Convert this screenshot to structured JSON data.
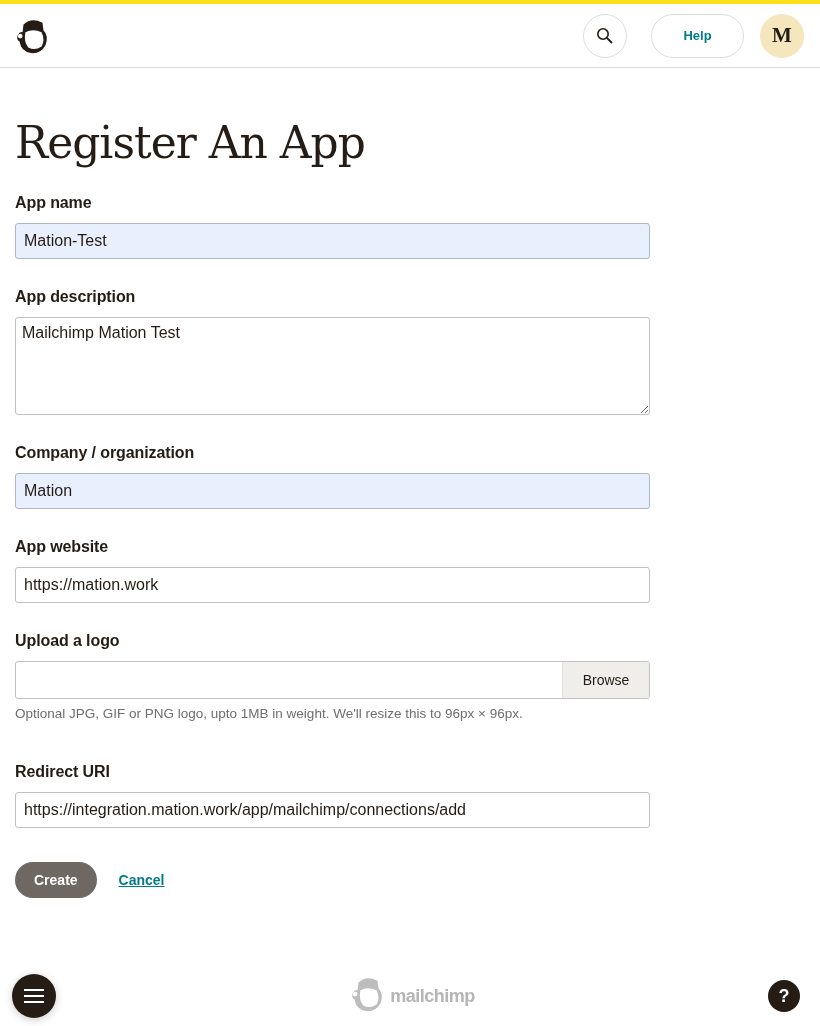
{
  "header": {
    "help": "Help",
    "avatar": "M"
  },
  "title": "Register An App",
  "fields": [
    {
      "kind": "input",
      "label": "App name",
      "value": "Mation-Test",
      "autofilled": true
    },
    {
      "kind": "textarea",
      "label": "App description",
      "value": "Mailchimp Mation Test",
      "autofilled": false
    },
    {
      "kind": "input",
      "label": "Company / organization",
      "value": "Mation",
      "autofilled": true
    },
    {
      "kind": "input",
      "label": "App website",
      "value": "https://mation.work",
      "autofilled": false
    },
    {
      "kind": "file",
      "label": "Upload a logo",
      "button": "Browse",
      "hint": "Optional JPG, GIF or PNG logo, upto 1MB in weight. We'll resize this to 96px × 96px."
    },
    {
      "kind": "input",
      "label": "Redirect URI",
      "value": "https://integration.mation.work/app/mailchimp/connections/add",
      "autofilled": false
    }
  ],
  "actions": {
    "primary": "Create",
    "cancel": "Cancel"
  },
  "footer": {
    "brand": "mailchimp",
    "help": "?"
  }
}
